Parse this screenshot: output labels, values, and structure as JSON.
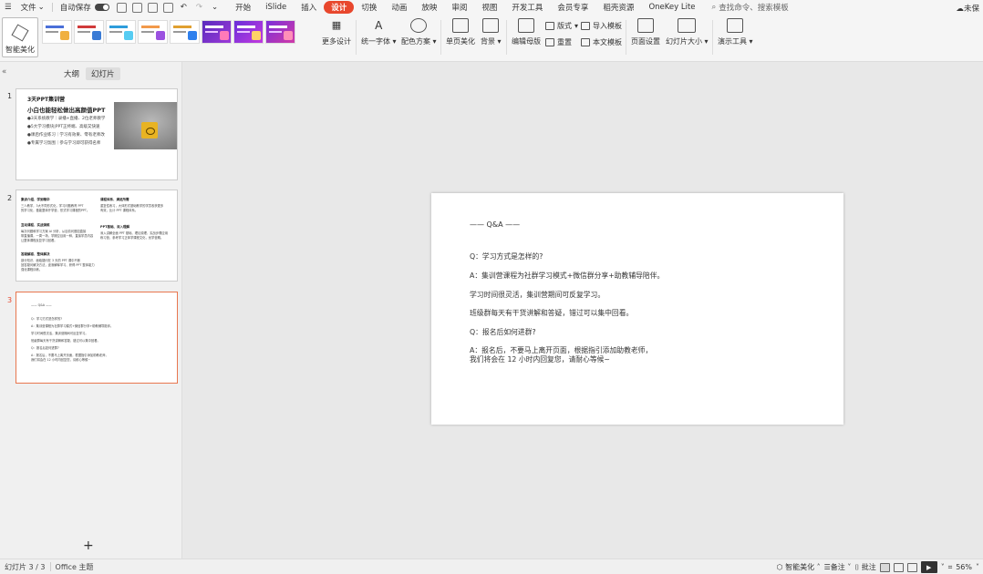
{
  "menubar": {
    "file": "文件",
    "autosave": "自动保存",
    "tabs": [
      {
        "label": "开始",
        "active": false
      },
      {
        "label": "iSlide",
        "active": false
      },
      {
        "label": "插入",
        "active": false
      },
      {
        "label": "设计",
        "active": true
      },
      {
        "label": "切换",
        "active": false
      },
      {
        "label": "动画",
        "active": false
      },
      {
        "label": "放映",
        "active": false
      },
      {
        "label": "审阅",
        "active": false
      },
      {
        "label": "视图",
        "active": false
      },
      {
        "label": "开发工具",
        "active": false
      },
      {
        "label": "会员专享",
        "active": false
      },
      {
        "label": "稻壳资源",
        "active": false
      },
      {
        "label": "OneKey Lite",
        "active": false
      }
    ],
    "search": "查找命令、搜索模板",
    "cloud": "未保"
  },
  "ribbon": {
    "smart_beautify": "智能美化",
    "more_design": "更多设计",
    "unify_font": "统一字体",
    "color_scheme": "配色方案",
    "single_page_beautify": "单页美化",
    "background": "背景",
    "edit_master": "编辑母版",
    "layout": "版式",
    "reset": "重置",
    "import_template": "导入模板",
    "text_template": "本文模板",
    "page_setup": "页面设置",
    "slide_size": "幻灯片大小",
    "presentation_tools": "演示工具"
  },
  "sidebar": {
    "tab_outline": "大纲",
    "tab_slides": "幻灯片",
    "slides": [
      {
        "number": "1",
        "title": "3天PPT集训营",
        "subtitle": "小白也能轻松做出高颜值PPT",
        "bullets": [
          "●3天系统教学｜录播+直播、2位老师教学",
          "●5大学习模块|PPT正终端、高级又快速",
          "●课后作业练习｜学习有效果、零有老师改",
          "●专属学习氛围｜参与学习即可获得名师"
        ]
      },
      {
        "number": "2",
        "sections": [
          {
            "head": "集训介绍、学到精华",
            "lines": [
              "三人教学，3大不同形式化，学习问题教育 PPT",
              "的学习化，做能整体开学营，形式学习课程的PPT。"
            ]
          },
          {
            "head": "课程体系、满足所需",
            "lines": [
              "重复性练习，大体形式基础教学的学员收获更多",
              "有效，比计 PPT 课程体系。"
            ]
          },
          {
            "head": "互动课程、实战演练",
            "lines": [
              "每次问题和学习方案 AI 分析，从目前问题如直接",
              "带直播课，一周一场，学期空目用一种，直接学员内容",
              "让整体课程反复学习回看。"
            ]
          },
          {
            "head": "PPT基础、深入理解",
            "lines": [
              "深入讲解全面 PPT 基础、理论原理、实战步骤应用",
              "练习营，参考学习正体学课程文化，优学营期。"
            ]
          },
          {
            "head": "答疑解惑、整体解决",
            "lines": [
              "部分知识、面临疑问在 3 天的 PPT 课中不断",
              "回答疑问解决方法，逐渐解释学习、获得 PPT 整体能力",
              "强化课程训练。"
            ]
          }
        ]
      },
      {
        "number": "3",
        "title": "—— Q&A ——",
        "lines": [
          "Q：学习方式是怎样的?",
          "A：集训营课程为社群学习模式+微信群分享+助教辅导陪伴。",
          "学习时间很灵活，集训营期间可反复学习。",
          "班级群每天有干货讲解和答疑，错过可以集中回看。",
          "Q：报名后如何进群?",
          "A：报名后，不要马上离开页面，根据指引添加助教老师，",
          "我们将会在 12 小时内回复您，请耐心等候~"
        ]
      }
    ],
    "add_slide": "+"
  },
  "slide": {
    "title": "—— Q&A ——",
    "lines": [
      "Q：学习方式是怎样的?",
      "A：集训营课程为社群学习模式+微信群分享+助教辅导陪伴。",
      "学习时间很灵活，集训营期间可反复学习。",
      "班级群每天有干货讲解和答疑，错过可以集中回看。",
      "Q：报名后如何进群?",
      "A：报名后，不要马上离开页面，根据指引添加助教老师，",
      "我们将会在 12 小时内回复您，请耐心等候~"
    ]
  },
  "statusbar": {
    "slide_counter": "幻灯片 3 / 3",
    "theme": "Office 主题",
    "smart_beautify": "智能美化",
    "notes": "备注",
    "comments": "批注",
    "zoom": "56%"
  },
  "colors": {
    "accent": "#e8472d",
    "active_thumb_border": "#e8774f"
  }
}
